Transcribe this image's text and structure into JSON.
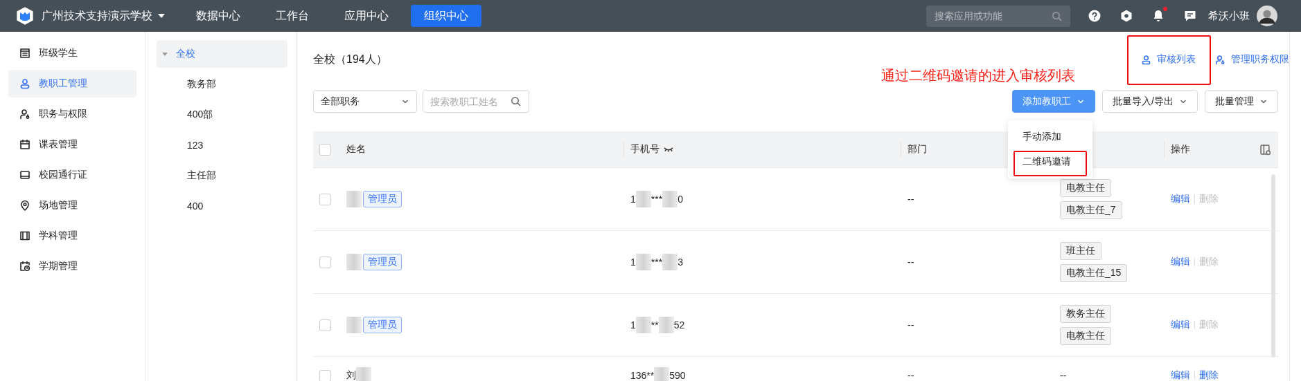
{
  "topbar": {
    "school": "广州技术支持演示学校",
    "tabs": [
      {
        "label": "数据中心",
        "selected": false
      },
      {
        "label": "工作台",
        "selected": false
      },
      {
        "label": "应用中心",
        "selected": false
      },
      {
        "label": "组织中心",
        "selected": true
      }
    ],
    "search": {
      "placeholder": "搜索应用或功能"
    },
    "notification_dot": true,
    "user": "希沃小班"
  },
  "sidebar": {
    "items": [
      {
        "label": "班级学生",
        "selected": false
      },
      {
        "label": "教职工管理",
        "selected": true
      },
      {
        "label": "职务与权限",
        "selected": false
      },
      {
        "label": "课表管理",
        "selected": false
      },
      {
        "label": "校园通行证",
        "selected": false
      },
      {
        "label": "场地管理",
        "selected": false
      },
      {
        "label": "学科管理",
        "selected": false
      },
      {
        "label": "学期管理",
        "selected": false
      }
    ]
  },
  "departments": [
    {
      "label": "全校",
      "selected": true,
      "expanded": true,
      "children": [
        {
          "label": "教务部",
          "selected": false
        },
        {
          "label": "400部",
          "selected": false
        },
        {
          "label": "123",
          "selected": false
        },
        {
          "label": "主任部",
          "selected": false
        },
        {
          "label": "400",
          "selected": false
        }
      ]
    }
  ],
  "main": {
    "title": "全校（194人）",
    "links": [
      {
        "label": "审核列表",
        "highlighted": true
      },
      {
        "label": "管理职务权限",
        "highlighted": false
      }
    ],
    "annotation": "通过二维码邀请的进入审核列表",
    "role_filter": {
      "value": "全部职务"
    },
    "name_search": {
      "placeholder": "搜索教职工姓名"
    },
    "buttons": [
      {
        "label": "添加教职工",
        "primary": true
      },
      {
        "label": "批量导入/导出",
        "primary": false
      },
      {
        "label": "批量管理",
        "primary": false
      }
    ],
    "add_menu": [
      {
        "label": "手动添加",
        "highlighted": false
      },
      {
        "label": "二维码邀请",
        "highlighted": true
      }
    ],
    "table": {
      "columns": [
        "姓名",
        "手机号",
        "部门",
        "操作"
      ],
      "all_checked": false,
      "rows": [
        {
          "checked": false,
          "name": [
            {
              "kind": "blur"
            }
          ],
          "tag": "管理员",
          "phone": [
            {
              "kind": "text",
              "text": "1"
            },
            {
              "kind": "blur"
            },
            {
              "kind": "text",
              "text": "***"
            },
            {
              "kind": "blur"
            },
            {
              "kind": "text",
              "text": "0"
            }
          ],
          "department": "--",
          "roles": [
            "电教主任",
            "电教主任_7"
          ],
          "edit": "编辑",
          "delete": {
            "label": "删除",
            "disabled": true
          }
        },
        {
          "checked": false,
          "name": [
            {
              "kind": "blur"
            }
          ],
          "tag": "管理员",
          "phone": [
            {
              "kind": "text",
              "text": "1"
            },
            {
              "kind": "blur"
            },
            {
              "kind": "text",
              "text": "***"
            },
            {
              "kind": "blur"
            },
            {
              "kind": "text",
              "text": "3"
            }
          ],
          "department": "--",
          "roles": [
            "班主任",
            "电教主任_15"
          ],
          "edit": "编辑",
          "delete": {
            "label": "删除",
            "disabled": true
          }
        },
        {
          "checked": false,
          "name": [
            {
              "kind": "blur"
            }
          ],
          "tag": "管理员",
          "phone": [
            {
              "kind": "text",
              "text": "1"
            },
            {
              "kind": "blur"
            },
            {
              "kind": "text",
              "text": "**"
            },
            {
              "kind": "blur"
            },
            {
              "kind": "text",
              "text": "52"
            }
          ],
          "department": "--",
          "roles": [
            "教务主任",
            "电教主任"
          ],
          "edit": "编辑",
          "delete": {
            "label": "删除",
            "disabled": true
          }
        },
        {
          "checked": false,
          "name": [
            {
              "kind": "text",
              "text": "刘"
            },
            {
              "kind": "blur"
            }
          ],
          "phone": [
            {
              "kind": "text",
              "text": "136**"
            },
            {
              "kind": "blur"
            },
            {
              "kind": "text",
              "text": "590"
            }
          ],
          "department": "--",
          "roles_text": "--",
          "edit": "编辑",
          "delete": {
            "label": "删除",
            "disabled": false
          }
        }
      ]
    }
  }
}
